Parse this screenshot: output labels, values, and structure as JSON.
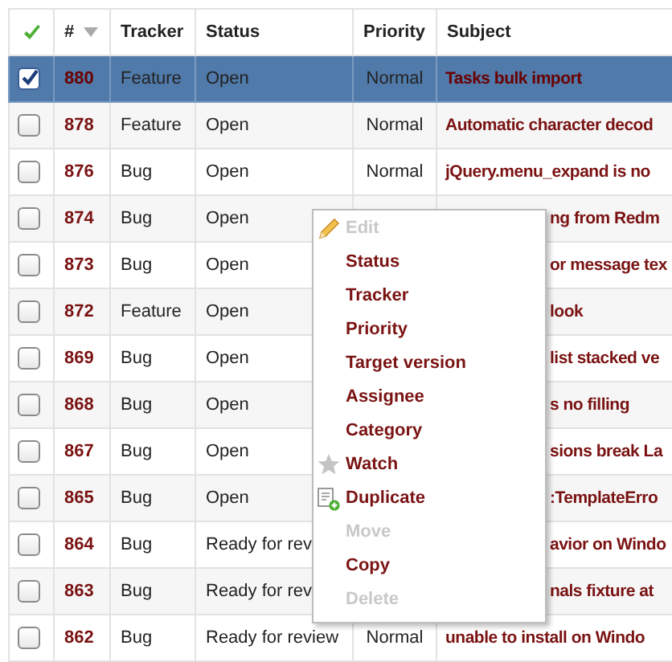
{
  "table": {
    "columns": [
      {
        "kind": "check"
      },
      {
        "kind": "sort",
        "label": "#"
      },
      {
        "kind": "text",
        "label": "Tracker"
      },
      {
        "kind": "text",
        "label": "Status"
      },
      {
        "kind": "text",
        "label": "Priority"
      },
      {
        "kind": "text",
        "label": "Subject"
      }
    ],
    "rows": [
      {
        "selected": true,
        "id": "880",
        "tracker": "Feature",
        "status": "Open",
        "priority": "Normal",
        "subject": "Tasks bulk import"
      },
      {
        "selected": false,
        "id": "878",
        "tracker": "Feature",
        "status": "Open",
        "priority": "Normal",
        "subject": "Automatic character decod"
      },
      {
        "selected": false,
        "id": "876",
        "tracker": "Bug",
        "status": "Open",
        "priority": "Normal",
        "subject": "jQuery.menu_expand is no"
      },
      {
        "selected": false,
        "id": "874",
        "tracker": "Bug",
        "status": "Open",
        "subject": "ng from Redm"
      },
      {
        "selected": false,
        "id": "873",
        "tracker": "Bug",
        "status": "Open",
        "subject": "or message tex"
      },
      {
        "selected": false,
        "id": "872",
        "tracker": "Feature",
        "status": "Open",
        "subject": "look"
      },
      {
        "selected": false,
        "id": "869",
        "tracker": "Bug",
        "status": "Open",
        "subject": "list stacked ve"
      },
      {
        "selected": false,
        "id": "868",
        "tracker": "Bug",
        "status": "Open",
        "subject": "s no filling"
      },
      {
        "selected": false,
        "id": "867",
        "tracker": "Bug",
        "status": "Open",
        "subject": "sions break La"
      },
      {
        "selected": false,
        "id": "865",
        "tracker": "Bug",
        "status": "Open",
        "subject": ":TemplateErro"
      },
      {
        "selected": false,
        "id": "864",
        "tracker": "Bug",
        "status": "Ready for rev",
        "subject": "avior on Windo"
      },
      {
        "selected": false,
        "id": "863",
        "tracker": "Bug",
        "status": "Ready for rev",
        "subject": "nals fixture at"
      },
      {
        "selected": false,
        "id": "862",
        "tracker": "Bug",
        "status": "Ready for review",
        "priority": "Normal",
        "subject": "unable to install on Windo"
      }
    ]
  },
  "context_menu": {
    "items": [
      {
        "label": "Edit",
        "kind": "edit",
        "disabled": true
      },
      {
        "label": "Status",
        "kind": "plain",
        "disabled": false
      },
      {
        "label": "Tracker",
        "kind": "plain",
        "disabled": false
      },
      {
        "label": "Priority",
        "kind": "plain",
        "disabled": false
      },
      {
        "label": "Target version",
        "kind": "plain",
        "disabled": false
      },
      {
        "label": "Assignee",
        "kind": "plain",
        "disabled": false
      },
      {
        "label": "Category",
        "kind": "plain",
        "disabled": false
      },
      {
        "label": "Watch",
        "kind": "watch",
        "disabled": false
      },
      {
        "label": "Duplicate",
        "kind": "duplicate",
        "disabled": false
      },
      {
        "label": "Move",
        "kind": "plain",
        "disabled": true
      },
      {
        "label": "Copy",
        "kind": "plain",
        "disabled": false
      },
      {
        "label": "Delete",
        "kind": "plain",
        "disabled": true
      }
    ]
  }
}
